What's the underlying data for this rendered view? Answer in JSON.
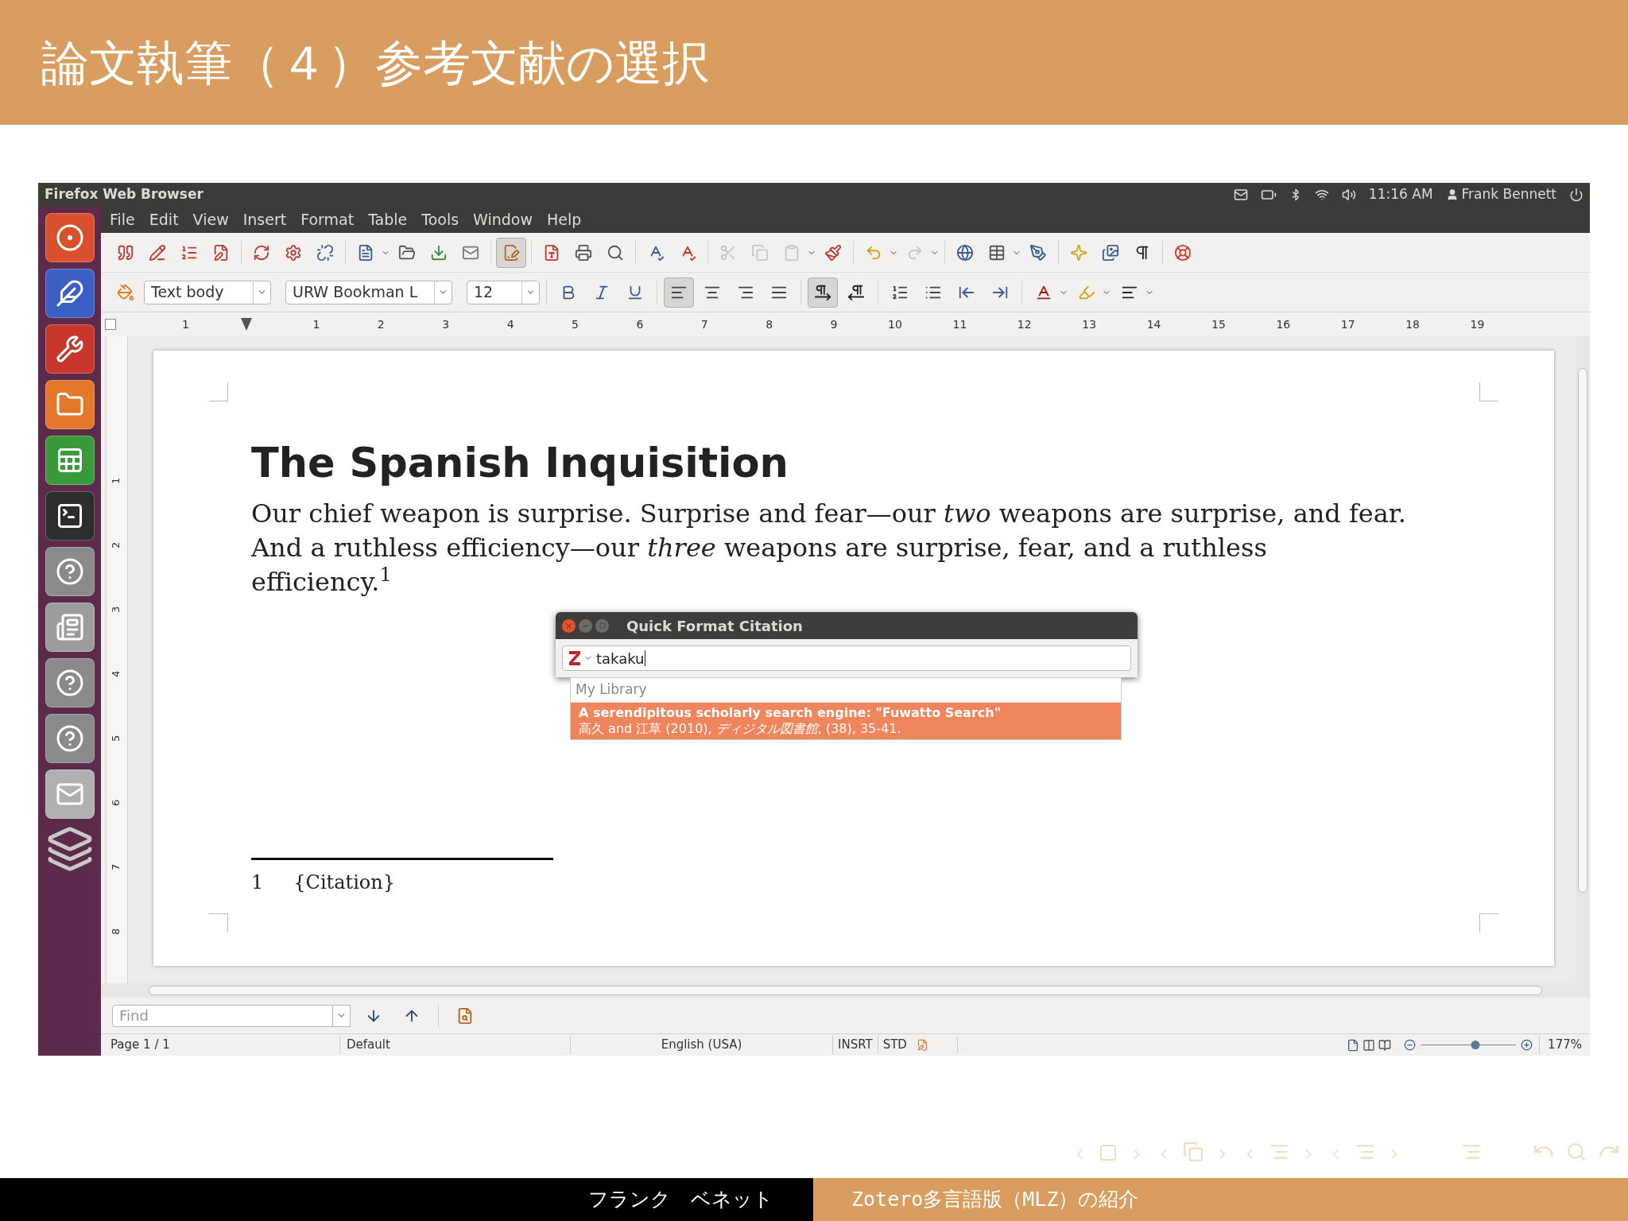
{
  "slide": {
    "title": "論文執筆（４）参考文献の選択"
  },
  "top_bar": {
    "app_title": "Firefox Web Browser",
    "time": "11:16 AM",
    "user": "Frank Bennett"
  },
  "menu": [
    "File",
    "Edit",
    "View",
    "Insert",
    "Format",
    "Table",
    "Tools",
    "Window",
    "Help"
  ],
  "toolbar": {
    "edit_mode_on": true,
    "paragraph_style": "Text body",
    "font_name": "URW Bookman L",
    "font_size": "12",
    "align_left_on": true,
    "align_center_on": false,
    "align_right_on": false,
    "justify_on": false,
    "left_to_right_on": true,
    "right_to_left_on": false
  },
  "ruler": {
    "first": "1",
    "numbers": [
      "1",
      "2",
      "3",
      "4",
      "5",
      "6",
      "7",
      "8",
      "9",
      "10",
      "11",
      "12",
      "13",
      "14",
      "15",
      "16",
      "17",
      "18",
      "19"
    ]
  },
  "vertical_ruler": [
    "1",
    "2",
    "3",
    "4",
    "5",
    "6",
    "7",
    "8"
  ],
  "document": {
    "heading": "The Spanish Inquisition",
    "paragraph": "Our chief weapon is surprise. Surprise and fear—our *two* weapons are surprise, and fear. And a ruthless efficiency—our *three* weapons are surprise, fear, and a ruthless efficiency.$^{1}$",
    "footnote": {
      "number": "1",
      "text": "{Citation}"
    }
  },
  "dialog": {
    "title": "Quick Format Citation",
    "query": "takaku",
    "group": "My Library",
    "results": [
      {
        "title": "A serendipitous scholarly search engine: \"Fuwatto Search\"",
        "detail": "高久 and 江草 (2010), *ディジタル図書館*, (38), 35-41.",
        "selected": true
      }
    ]
  },
  "find_bar": {
    "placeholder": "Find"
  },
  "status_bar": {
    "page": "Page 1 / 1",
    "style": "Default",
    "language": "English (USA)",
    "insert_mode": "INSRT",
    "selection_mode": "STD",
    "zoom": {
      "level": 0.57,
      "reading": "177%"
    }
  },
  "footer": {
    "author": "フランク　ベネット",
    "talk_title": "Zotero多言語版（MLZ）の紹介"
  }
}
